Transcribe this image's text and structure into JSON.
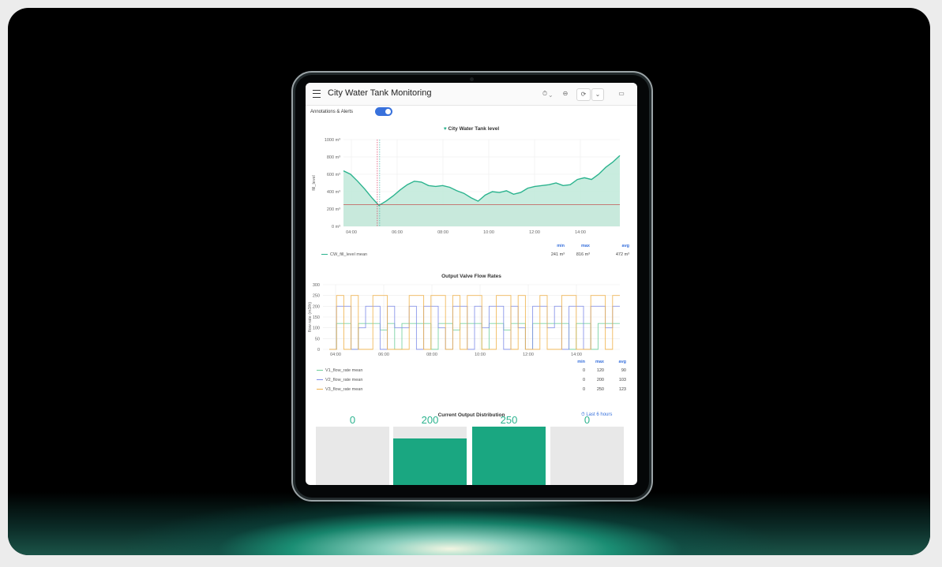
{
  "app": {
    "title": "City Water Tank Monitoring"
  },
  "toolbar": {
    "time_label": "⏱ ⌄",
    "zoom_label": "⊖",
    "refresh_label": "⟳",
    "more_label": "⌄",
    "tv_label": "▭"
  },
  "annotations": {
    "label": "Annotations & Alerts",
    "enabled": true
  },
  "panel1": {
    "title": "City Water Tank level",
    "ylabel": "fill_level",
    "legend": [
      {
        "name": "CW_fill_level mean",
        "color": "#2bb38e"
      }
    ],
    "stats_headers": [
      "min",
      "max",
      "avg"
    ],
    "stats_row": [
      "241 m³",
      "816 m³",
      "472 m³"
    ]
  },
  "panel2": {
    "title": "Output Valve Flow Rates",
    "ylabel": "flow rate (m3/h)",
    "legend": [
      {
        "name": "V1_flow_rate mean",
        "color": "#6ecf9a",
        "min": "0",
        "max": "120",
        "avg": "90"
      },
      {
        "name": "V2_flow_rate mean",
        "color": "#7f8de8",
        "min": "0",
        "max": "200",
        "avg": "103"
      },
      {
        "name": "V3_flow_rate mean",
        "color": "#f0b14a",
        "min": "0",
        "max": "250",
        "avg": "123"
      }
    ],
    "stats_headers": [
      "min",
      "max",
      "avg"
    ]
  },
  "distribution": {
    "title": "Current Output Distribution",
    "time_range": "⏱ Last 6 hours",
    "bars": [
      {
        "value": "0",
        "fraction": 0
      },
      {
        "value": "200",
        "fraction": 0.8
      },
      {
        "value": "250",
        "fraction": 1.0
      },
      {
        "value": "0",
        "fraction": 0
      }
    ]
  },
  "chart_data": [
    {
      "type": "area",
      "title": "City Water Tank level",
      "ylabel": "fill_level",
      "x_ticks": [
        "04:00",
        "06:00",
        "08:00",
        "10:00",
        "12:00",
        "14:00"
      ],
      "y_ticks": [
        "0 m³",
        "200 m³",
        "400 m³",
        "600 m³",
        "800 m³",
        "1000 m³"
      ],
      "ylim": [
        0,
        1000
      ],
      "threshold": 250,
      "series": [
        {
          "name": "CW_fill_level mean",
          "values": [
            640,
            600,
            520,
            430,
            330,
            241,
            290,
            350,
            420,
            480,
            520,
            510,
            470,
            460,
            470,
            450,
            410,
            380,
            330,
            290,
            360,
            400,
            390,
            410,
            370,
            390,
            440,
            460,
            470,
            480,
            500,
            470,
            480,
            540,
            560,
            540,
            600,
            680,
            740,
            816
          ]
        }
      ]
    },
    {
      "type": "line",
      "title": "Output Valve Flow Rates",
      "ylabel": "flow rate (m3/h)",
      "x_ticks": [
        "04:00",
        "06:00",
        "08:00",
        "10:00",
        "12:00",
        "14:00"
      ],
      "y_ticks": [
        "0",
        "50",
        "100",
        "150",
        "200",
        "250",
        "300"
      ],
      "ylim": [
        0,
        300
      ],
      "series": [
        {
          "name": "V1_flow_rate mean",
          "values": [
            0,
            120,
            120,
            0,
            120,
            120,
            120,
            90,
            120,
            0,
            120,
            120,
            120,
            120,
            0,
            120,
            120,
            90,
            120,
            120,
            120,
            0,
            120,
            120,
            90,
            120,
            120,
            0,
            120,
            120,
            120,
            120,
            120,
            0,
            120,
            120,
            0,
            120,
            120,
            120
          ]
        },
        {
          "name": "V2_flow_rate mean",
          "values": [
            0,
            200,
            200,
            0,
            100,
            200,
            200,
            0,
            200,
            100,
            100,
            200,
            0,
            200,
            200,
            100,
            0,
            200,
            200,
            0,
            200,
            100,
            200,
            200,
            0,
            200,
            100,
            0,
            200,
            200,
            100,
            200,
            0,
            200,
            200,
            0,
            200,
            200,
            100,
            200
          ]
        },
        {
          "name": "V3_flow_rate mean",
          "values": [
            0,
            250,
            0,
            250,
            0,
            0,
            250,
            250,
            0,
            0,
            0,
            250,
            250,
            0,
            250,
            250,
            0,
            250,
            0,
            250,
            250,
            0,
            0,
            250,
            250,
            0,
            250,
            0,
            0,
            250,
            0,
            0,
            250,
            250,
            0,
            0,
            250,
            250,
            0,
            250
          ]
        }
      ]
    }
  ]
}
